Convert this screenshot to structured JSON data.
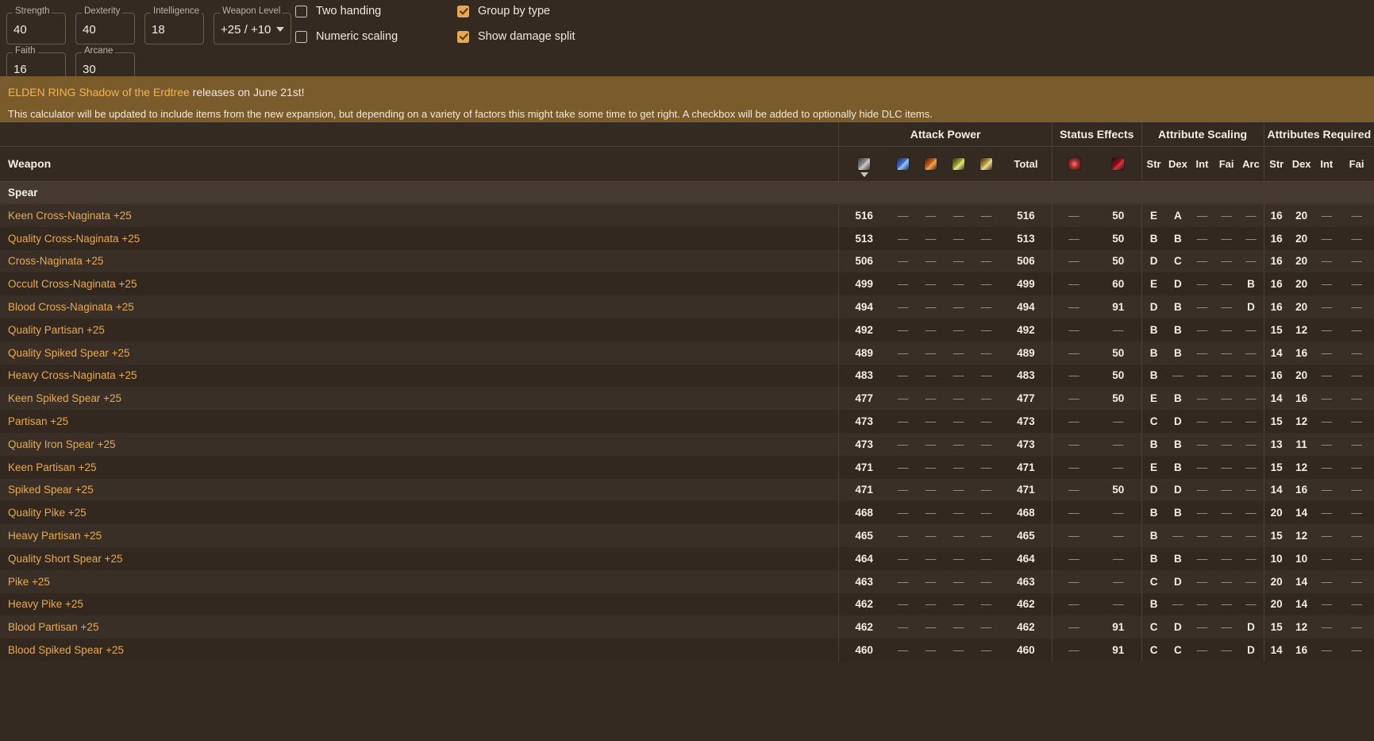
{
  "stats": {
    "fields": [
      {
        "label": "Strength",
        "value": "40",
        "type": "input"
      },
      {
        "label": "Dexterity",
        "value": "40",
        "type": "input"
      },
      {
        "label": "Intelligence",
        "value": "18",
        "type": "input"
      },
      {
        "label": "Weapon Level",
        "value": "+25 / +10",
        "type": "select"
      },
      {
        "label": "Faith",
        "value": "16",
        "type": "input"
      },
      {
        "label": "Arcane",
        "value": "30",
        "type": "input"
      }
    ]
  },
  "options": [
    {
      "label": "Two handing",
      "checked": false
    },
    {
      "label": "Group by type",
      "checked": true
    },
    {
      "label": "Numeric scaling",
      "checked": false
    },
    {
      "label": "Show damage split",
      "checked": true
    }
  ],
  "banner": {
    "headline_highlight": "ELDEN RING Shadow of the Erdtree",
    "headline_rest": " releases on June 21st!",
    "body": "This calculator will be updated to include items from the new expansion, but depending on a variety of factors this might take some time to get right. A checkbox will be added to optionally hide DLC items."
  },
  "table": {
    "group_headers": [
      {
        "label": "",
        "span": 1
      },
      {
        "label": "Attack Power",
        "span": 6
      },
      {
        "label": "Status Effects",
        "span": 2
      },
      {
        "label": "Attribute Scaling",
        "span": 5
      },
      {
        "label": "Attributes Required",
        "span": 4
      }
    ],
    "weapon_column": "Weapon",
    "damage_icons": [
      "physical-icon",
      "magic-icon",
      "fire-icon",
      "lightning-icon",
      "holy-icon"
    ],
    "total_label": "Total",
    "status_icons": [
      "poison-icon",
      "bleed-icon"
    ],
    "scaling_headers": [
      "Str",
      "Dex",
      "Int",
      "Fai",
      "Arc"
    ],
    "required_headers": [
      "Str",
      "Dex",
      "Int",
      "Fai"
    ],
    "sort_column": "physical",
    "sort_direction": "desc",
    "group_label": "Spear",
    "rows": [
      {
        "name": "Keen Cross-Naginata +25",
        "phys": "516",
        "mag": "—",
        "fire": "—",
        "lit": "—",
        "holy": "—",
        "total": "516",
        "poison": "—",
        "bleed": "50",
        "scaling": [
          "E",
          "A",
          "—",
          "—",
          "—"
        ],
        "req": [
          "16",
          "20",
          "—",
          "—"
        ]
      },
      {
        "name": "Quality Cross-Naginata +25",
        "phys": "513",
        "mag": "—",
        "fire": "—",
        "lit": "—",
        "holy": "—",
        "total": "513",
        "poison": "—",
        "bleed": "50",
        "scaling": [
          "B",
          "B",
          "—",
          "—",
          "—"
        ],
        "req": [
          "16",
          "20",
          "—",
          "—"
        ]
      },
      {
        "name": "Cross-Naginata +25",
        "phys": "506",
        "mag": "—",
        "fire": "—",
        "lit": "—",
        "holy": "—",
        "total": "506",
        "poison": "—",
        "bleed": "50",
        "scaling": [
          "D",
          "C",
          "—",
          "—",
          "—"
        ],
        "req": [
          "16",
          "20",
          "—",
          "—"
        ]
      },
      {
        "name": "Occult Cross-Naginata +25",
        "phys": "499",
        "mag": "—",
        "fire": "—",
        "lit": "—",
        "holy": "—",
        "total": "499",
        "poison": "—",
        "bleed": "60",
        "scaling": [
          "E",
          "D",
          "—",
          "—",
          "B"
        ],
        "req": [
          "16",
          "20",
          "—",
          "—"
        ]
      },
      {
        "name": "Blood Cross-Naginata +25",
        "phys": "494",
        "mag": "—",
        "fire": "—",
        "lit": "—",
        "holy": "—",
        "total": "494",
        "poison": "—",
        "bleed": "91",
        "scaling": [
          "D",
          "B",
          "—",
          "—",
          "D"
        ],
        "req": [
          "16",
          "20",
          "—",
          "—"
        ]
      },
      {
        "name": "Quality Partisan +25",
        "phys": "492",
        "mag": "—",
        "fire": "—",
        "lit": "—",
        "holy": "—",
        "total": "492",
        "poison": "—",
        "bleed": "—",
        "scaling": [
          "B",
          "B",
          "—",
          "—",
          "—"
        ],
        "req": [
          "15",
          "12",
          "—",
          "—"
        ]
      },
      {
        "name": "Quality Spiked Spear +25",
        "phys": "489",
        "mag": "—",
        "fire": "—",
        "lit": "—",
        "holy": "—",
        "total": "489",
        "poison": "—",
        "bleed": "50",
        "scaling": [
          "B",
          "B",
          "—",
          "—",
          "—"
        ],
        "req": [
          "14",
          "16",
          "—",
          "—"
        ]
      },
      {
        "name": "Heavy Cross-Naginata +25",
        "phys": "483",
        "mag": "—",
        "fire": "—",
        "lit": "—",
        "holy": "—",
        "total": "483",
        "poison": "—",
        "bleed": "50",
        "scaling": [
          "B",
          "—",
          "—",
          "—",
          "—"
        ],
        "req": [
          "16",
          "20",
          "—",
          "—"
        ]
      },
      {
        "name": "Keen Spiked Spear +25",
        "phys": "477",
        "mag": "—",
        "fire": "—",
        "lit": "—",
        "holy": "—",
        "total": "477",
        "poison": "—",
        "bleed": "50",
        "scaling": [
          "E",
          "B",
          "—",
          "—",
          "—"
        ],
        "req": [
          "14",
          "16",
          "—",
          "—"
        ]
      },
      {
        "name": "Partisan +25",
        "phys": "473",
        "mag": "—",
        "fire": "—",
        "lit": "—",
        "holy": "—",
        "total": "473",
        "poison": "—",
        "bleed": "—",
        "scaling": [
          "C",
          "D",
          "—",
          "—",
          "—"
        ],
        "req": [
          "15",
          "12",
          "—",
          "—"
        ]
      },
      {
        "name": "Quality Iron Spear +25",
        "phys": "473",
        "mag": "—",
        "fire": "—",
        "lit": "—",
        "holy": "—",
        "total": "473",
        "poison": "—",
        "bleed": "—",
        "scaling": [
          "B",
          "B",
          "—",
          "—",
          "—"
        ],
        "req": [
          "13",
          "11",
          "—",
          "—"
        ]
      },
      {
        "name": "Keen Partisan +25",
        "phys": "471",
        "mag": "—",
        "fire": "—",
        "lit": "—",
        "holy": "—",
        "total": "471",
        "poison": "—",
        "bleed": "—",
        "scaling": [
          "E",
          "B",
          "—",
          "—",
          "—"
        ],
        "req": [
          "15",
          "12",
          "—",
          "—"
        ]
      },
      {
        "name": "Spiked Spear +25",
        "phys": "471",
        "mag": "—",
        "fire": "—",
        "lit": "—",
        "holy": "—",
        "total": "471",
        "poison": "—",
        "bleed": "50",
        "scaling": [
          "D",
          "D",
          "—",
          "—",
          "—"
        ],
        "req": [
          "14",
          "16",
          "—",
          "—"
        ]
      },
      {
        "name": "Quality Pike +25",
        "phys": "468",
        "mag": "—",
        "fire": "—",
        "lit": "—",
        "holy": "—",
        "total": "468",
        "poison": "—",
        "bleed": "—",
        "scaling": [
          "B",
          "B",
          "—",
          "—",
          "—"
        ],
        "req": [
          "20",
          "14",
          "—",
          "—"
        ]
      },
      {
        "name": "Heavy Partisan +25",
        "phys": "465",
        "mag": "—",
        "fire": "—",
        "lit": "—",
        "holy": "—",
        "total": "465",
        "poison": "—",
        "bleed": "—",
        "scaling": [
          "B",
          "—",
          "—",
          "—",
          "—"
        ],
        "req": [
          "15",
          "12",
          "—",
          "—"
        ]
      },
      {
        "name": "Quality Short Spear +25",
        "phys": "464",
        "mag": "—",
        "fire": "—",
        "lit": "—",
        "holy": "—",
        "total": "464",
        "poison": "—",
        "bleed": "—",
        "scaling": [
          "B",
          "B",
          "—",
          "—",
          "—"
        ],
        "req": [
          "10",
          "10",
          "—",
          "—"
        ]
      },
      {
        "name": "Pike +25",
        "phys": "463",
        "mag": "—",
        "fire": "—",
        "lit": "—",
        "holy": "—",
        "total": "463",
        "poison": "—",
        "bleed": "—",
        "scaling": [
          "C",
          "D",
          "—",
          "—",
          "—"
        ],
        "req": [
          "20",
          "14",
          "—",
          "—"
        ]
      },
      {
        "name": "Heavy Pike +25",
        "phys": "462",
        "mag": "—",
        "fire": "—",
        "lit": "—",
        "holy": "—",
        "total": "462",
        "poison": "—",
        "bleed": "—",
        "scaling": [
          "B",
          "—",
          "—",
          "—",
          "—"
        ],
        "req": [
          "20",
          "14",
          "—",
          "—"
        ]
      },
      {
        "name": "Blood Partisan +25",
        "phys": "462",
        "mag": "—",
        "fire": "—",
        "lit": "—",
        "holy": "—",
        "total": "462",
        "poison": "—",
        "bleed": "91",
        "scaling": [
          "C",
          "D",
          "—",
          "—",
          "D"
        ],
        "req": [
          "15",
          "12",
          "—",
          "—"
        ]
      },
      {
        "name": "Blood Spiked Spear +25",
        "phys": "460",
        "mag": "—",
        "fire": "—",
        "lit": "—",
        "holy": "—",
        "total": "460",
        "poison": "—",
        "bleed": "91",
        "scaling": [
          "C",
          "C",
          "—",
          "—",
          "D"
        ],
        "req": [
          "14",
          "16",
          "—",
          "—"
        ]
      }
    ]
  },
  "colors": {
    "background": "#342a22",
    "banner": "#7a5c2c",
    "accent": "#e8a84f",
    "weapon_link": "#e8a84f",
    "text": "#efe8dc"
  }
}
